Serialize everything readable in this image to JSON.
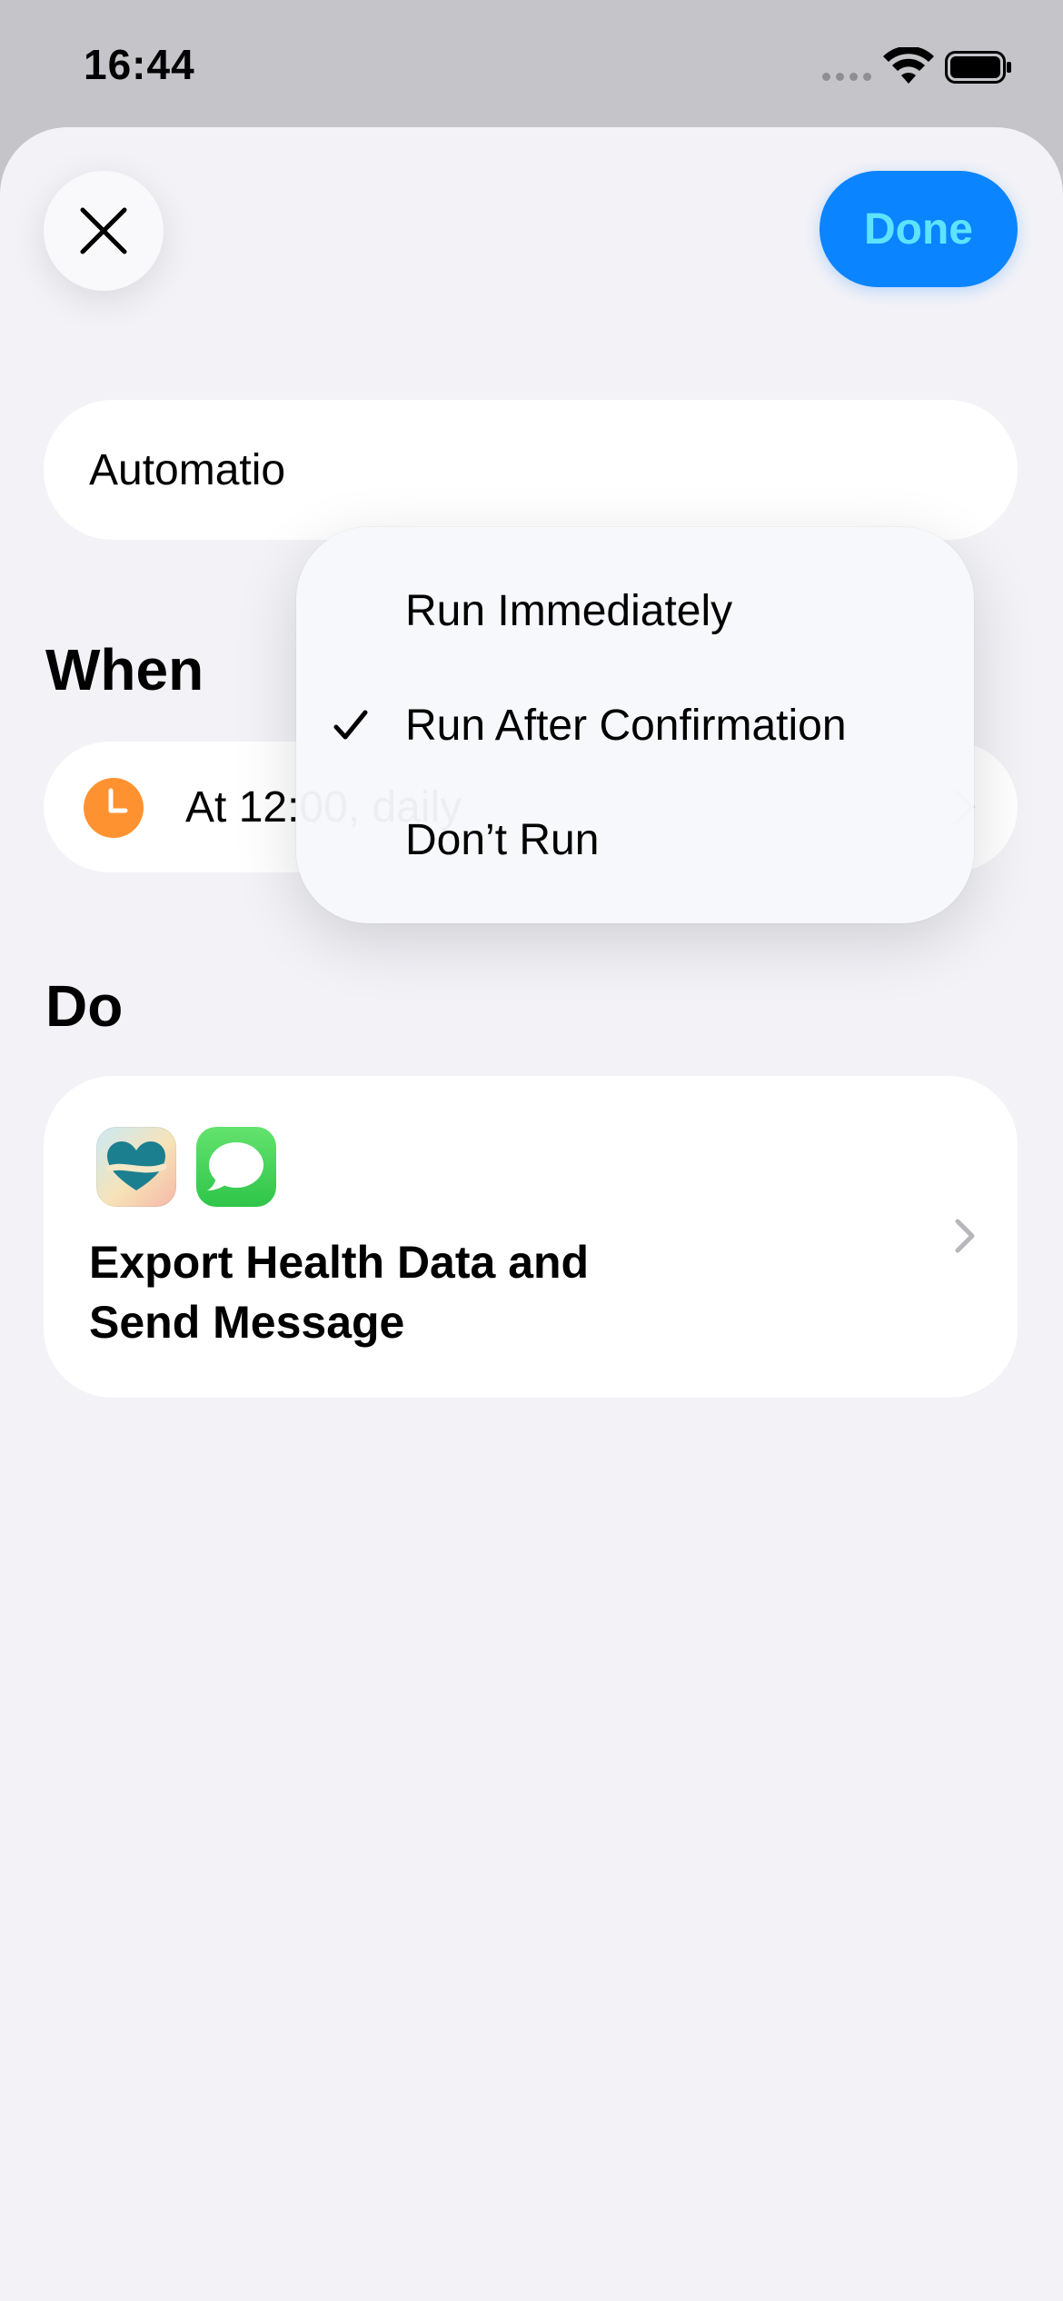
{
  "status_bar": {
    "time": "16:44",
    "icons": [
      "signal-icon",
      "wifi-icon",
      "battery-icon"
    ]
  },
  "toolbar": {
    "close_icon": "close-icon",
    "done_label": "Done"
  },
  "automation": {
    "label": "Automatio"
  },
  "when": {
    "title": "When",
    "trigger_label": "At 12:00, daily",
    "icon": "clock-icon"
  },
  "do": {
    "title": "Do",
    "action_label": "Export Health Data and\nSend Message",
    "icons": [
      "health-app-icon",
      "messages-app-icon"
    ]
  },
  "popup_menu": {
    "items": [
      {
        "label": "Run Immediately",
        "checked": false
      },
      {
        "label": "Run After Confirmation",
        "checked": true
      },
      {
        "label": "Don’t Run",
        "checked": false
      }
    ]
  },
  "colors": {
    "accent": "#0a84ff",
    "done_text": "#5ee3ff",
    "clock": "#ff9230",
    "background": "#f2f2f7"
  }
}
